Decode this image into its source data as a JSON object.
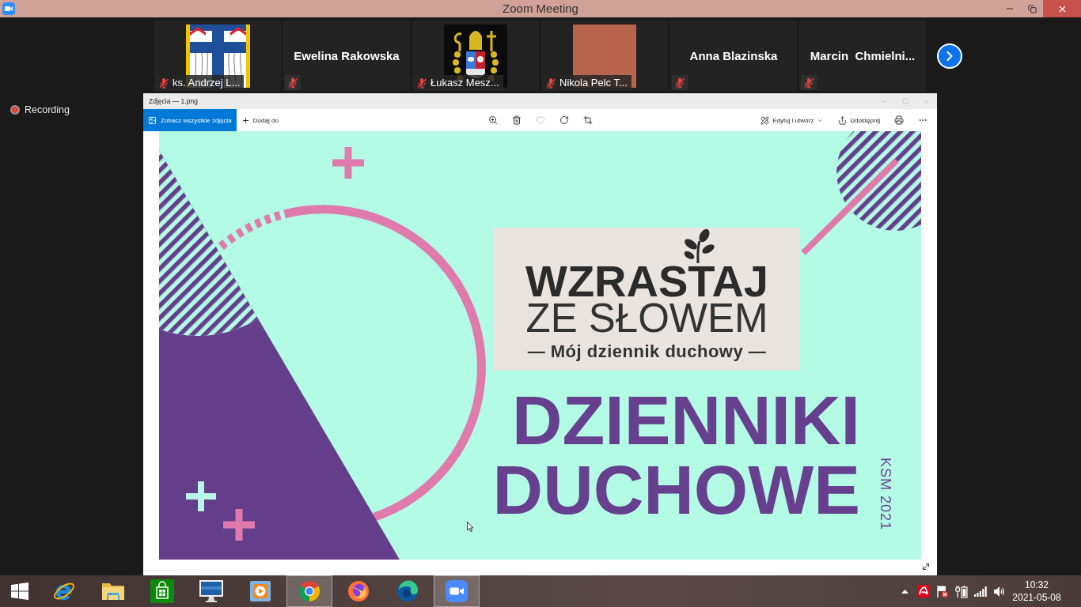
{
  "window": {
    "title": "Zoom Meeting"
  },
  "participants": [
    {
      "kind": "crest",
      "name": "ks. Andrzej L...",
      "muted": true
    },
    {
      "kind": "name",
      "name": "Ewelina Rakowska",
      "muted": true
    },
    {
      "kind": "mitre-crest",
      "name": "Łukasz Mesz...",
      "muted": true
    },
    {
      "kind": "photo",
      "name": "Nikola Pelc T...",
      "muted": true
    },
    {
      "kind": "name",
      "name": "Anna Blazinska",
      "muted": true
    },
    {
      "kind": "name",
      "name": "Marcin  Chmielni...",
      "muted": true
    }
  ],
  "recording": {
    "label": "Recording"
  },
  "photos_window": {
    "title": "Zdjęcia — 1.png",
    "toolbar": {
      "left": [
        {
          "kind": "primary",
          "label": "Zobacz wszystkie zdjęcia"
        },
        {
          "kind": "plain",
          "label": "Dodaj do"
        }
      ],
      "tools": [
        {
          "kind": "zoom",
          "disabled": false
        },
        {
          "kind": "delete",
          "disabled": false
        },
        {
          "kind": "favorite",
          "disabled": true
        },
        {
          "kind": "rotate",
          "disabled": false
        },
        {
          "kind": "crop",
          "disabled": false
        }
      ],
      "right": [
        {
          "kind": "edit",
          "label": "Edytuj i utwórz"
        },
        {
          "kind": "share",
          "label": "Udostępnij"
        },
        {
          "kind": "print"
        },
        {
          "kind": "more"
        }
      ]
    },
    "image": {
      "logo": {
        "title": "WZRASTAJ",
        "subtitle": "ZE SŁOWEM",
        "tagline": "— Mój dziennik duchowy —"
      },
      "headline": "DZIENNIKI DUCHOWE",
      "side_text": "KSM 2021"
    }
  },
  "taskbar": {
    "apps": [
      {
        "kind": "start",
        "highlighted": false
      },
      {
        "kind": "ie",
        "highlighted": false
      },
      {
        "kind": "explorer",
        "highlighted": false
      },
      {
        "kind": "store",
        "highlighted": false
      },
      {
        "kind": "monitor",
        "highlighted": false
      },
      {
        "kind": "player",
        "highlighted": false
      },
      {
        "kind": "chrome",
        "highlighted": true
      },
      {
        "kind": "firefox",
        "highlighted": false
      },
      {
        "kind": "edge",
        "highlighted": false
      },
      {
        "kind": "zoom",
        "highlighted": true
      }
    ],
    "clock": {
      "time": "10:32",
      "date": "2021-05-08"
    }
  }
}
